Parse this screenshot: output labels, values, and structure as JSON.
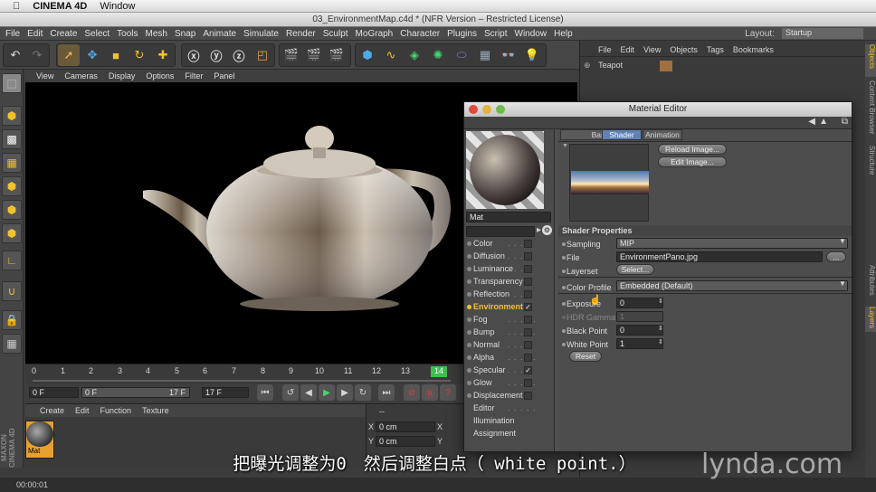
{
  "macmenu": {
    "app": "CINEMA 4D",
    "window": "Window"
  },
  "window_title": "03_EnvironmentMap.c4d * (NFR Version – Restricted License)",
  "menu": [
    "File",
    "Edit",
    "Create",
    "Select",
    "Tools",
    "Mesh",
    "Snap",
    "Animate",
    "Simulate",
    "Render",
    "Sculpt",
    "MoGraph",
    "Character",
    "Plugins",
    "Script",
    "Window",
    "Help"
  ],
  "layout": {
    "label": "Layout:",
    "value": "Startup"
  },
  "viewport_menu": [
    "View",
    "Cameras",
    "Display",
    "Options",
    "Filter",
    "Panel"
  ],
  "timeline": {
    "ticks": [
      "0",
      "1",
      "2",
      "3",
      "4",
      "5",
      "6",
      "7",
      "8",
      "9",
      "10",
      "11",
      "12",
      "13",
      "14"
    ],
    "current_frame": "14"
  },
  "transport": {
    "start": "0 F",
    "range_start": "0 F",
    "range_end": "17 F",
    "end": "17 F"
  },
  "material_manager": {
    "menu": [
      "Create",
      "Edit",
      "Function",
      "Texture"
    ],
    "material_name": "Mat"
  },
  "coords": {
    "header": "--",
    "x_label": "X",
    "y_label": "Y",
    "x_val": "0 cm",
    "y_val": "0 cm",
    "x2": "X",
    "y2": "Y"
  },
  "object_manager": {
    "menu": [
      "File",
      "Edit",
      "View",
      "Objects",
      "Tags",
      "Bookmarks"
    ],
    "object": "Teapot"
  },
  "side_tabs": [
    "Objects",
    "Content Browser",
    "Structure",
    "Attributes",
    "Layers"
  ],
  "material_editor": {
    "title": "Material Editor",
    "name": "Mat",
    "tabs": [
      "Basic",
      "Shader",
      "Animation"
    ],
    "active_tab": "Shader",
    "buttons": {
      "reload": "Reload Image...",
      "edit": "Edit Image..."
    },
    "channels": [
      {
        "name": "Color",
        "checked": ""
      },
      {
        "name": "Diffusion",
        "checked": ""
      },
      {
        "name": "Luminance",
        "checked": ""
      },
      {
        "name": "Transparency",
        "checked": ""
      },
      {
        "name": "Reflection",
        "checked": ""
      },
      {
        "name": "Environment",
        "checked": "✓"
      },
      {
        "name": "Fog",
        "checked": ""
      },
      {
        "name": "Bump",
        "checked": ""
      },
      {
        "name": "Normal",
        "checked": ""
      },
      {
        "name": "Alpha",
        "checked": ""
      },
      {
        "name": "Specular",
        "checked": "✓"
      },
      {
        "name": "Glow",
        "checked": ""
      },
      {
        "name": "Displacement",
        "checked": ""
      },
      {
        "name": "Editor",
        "checked": null
      },
      {
        "name": "Illumination",
        "checked": null
      },
      {
        "name": "Assignment",
        "checked": null
      }
    ],
    "shader_properties": {
      "header": "Shader Properties",
      "sampling_label": "Sampling",
      "sampling": "MIP",
      "file_label": "File",
      "file": "EnvironmentPano.jpg",
      "file_btn": "...",
      "layerset_label": "Layerset",
      "layerset_btn": "Select...",
      "color_profile_label": "Color Profile",
      "color_profile": "Embedded (Default)",
      "exposure_label": "Exposure",
      "exposure": "0",
      "hdr_gamma_label": "HDR Gamma",
      "hdr_gamma": "1",
      "black_point_label": "Black Point",
      "black_point": "0",
      "white_point_label": "White Point",
      "white_point": "1",
      "reset": "Reset"
    }
  },
  "status": "00:00:01",
  "subtitle": "把曝光调整为0　然后调整白点（ white point.）",
  "watermark": "lynda.com",
  "logo": "MAXON CINEMA 4D"
}
